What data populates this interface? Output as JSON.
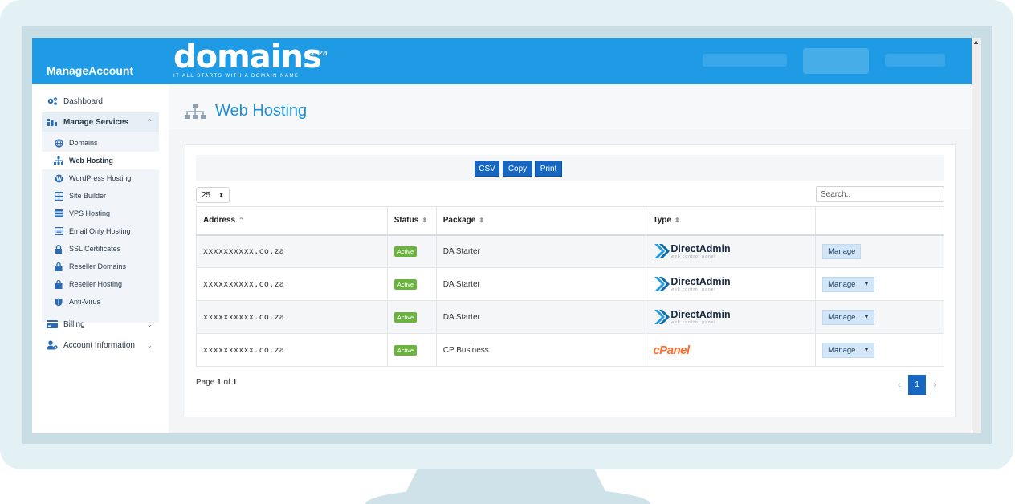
{
  "app": {
    "brand": "ManageAccount",
    "logo_main": "domains",
    "logo_tld": ".co.za",
    "logo_tagline": "IT ALL STARTS WITH A DOMAIN NAME"
  },
  "sidebar": {
    "items": [
      {
        "label": "Dashboard",
        "icon": "gears-icon"
      },
      {
        "label": "Manage Services",
        "icon": "services-icon"
      },
      {
        "label": "Billing",
        "icon": "credit-card-icon"
      },
      {
        "label": "Account Information",
        "icon": "user-gear-icon"
      }
    ],
    "sub_items": [
      {
        "label": "Domains",
        "icon": "globe-icon"
      },
      {
        "label": "Web Hosting",
        "icon": "sitemap-icon"
      },
      {
        "label": "WordPress Hosting",
        "icon": "wordpress-icon"
      },
      {
        "label": "Site Builder",
        "icon": "grid-icon"
      },
      {
        "label": "VPS Hosting",
        "icon": "server-icon"
      },
      {
        "label": "Email Only Hosting",
        "icon": "envelope-icon"
      },
      {
        "label": "SSL Certificates",
        "icon": "lock-icon"
      },
      {
        "label": "Reseller Domains",
        "icon": "bag-icon"
      },
      {
        "label": "Reseller Hosting",
        "icon": "bag-icon"
      },
      {
        "label": "Anti-Virus",
        "icon": "shield-icon"
      }
    ]
  },
  "page": {
    "title": "Web Hosting"
  },
  "toolbar": {
    "csv": "CSV",
    "copy": "Copy",
    "print": "Print"
  },
  "table": {
    "page_length": "25",
    "search_placeholder": "Search..",
    "headers": {
      "address": "Address",
      "status": "Status",
      "package": "Package",
      "type": "Type"
    },
    "rows": [
      {
        "address": "xxxxxxxxxx.co.za",
        "status": "Active",
        "package": "DA Starter",
        "type": "DirectAdmin",
        "type_sub": "web control panel",
        "action": "Manage"
      },
      {
        "address": "xxxxxxxxxx.co.za",
        "status": "Active",
        "package": "DA Starter",
        "type": "DirectAdmin",
        "type_sub": "web control panel",
        "action": "Manage"
      },
      {
        "address": "xxxxxxxxxx.co.za",
        "status": "Active",
        "package": "DA Starter",
        "type": "DirectAdmin",
        "type_sub": "web control panel",
        "action": "Manage"
      },
      {
        "address": "xxxxxxxxxx.co.za",
        "status": "Active",
        "package": "CP Business",
        "type": "cPanel",
        "action": "Manage"
      }
    ]
  },
  "pagination": {
    "prefix": "Page ",
    "current": "1",
    "of_text": " of ",
    "total": "1",
    "page_button": "1"
  },
  "colors": {
    "topbar": "#1e9be4",
    "accent_blue": "#1767c2",
    "status_active": "#6bb33e",
    "cpanel_orange": "#ff6c2c"
  }
}
